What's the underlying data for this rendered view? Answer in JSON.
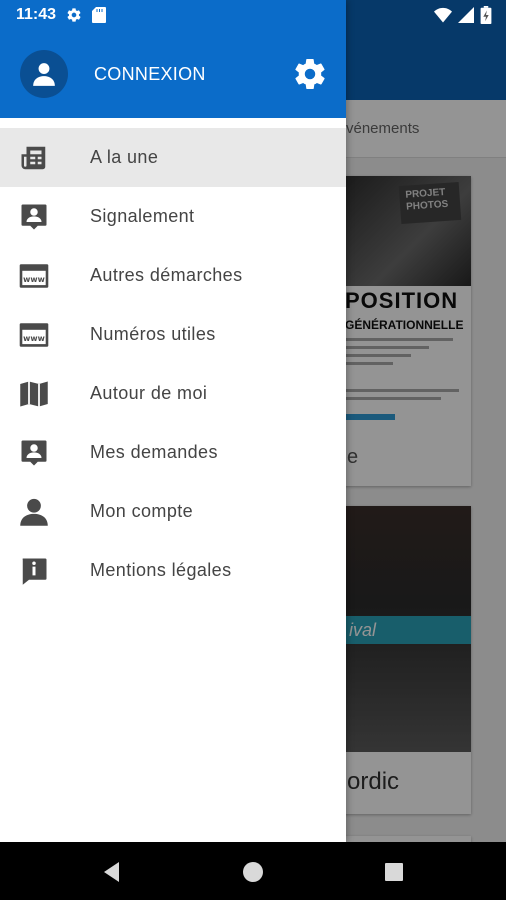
{
  "status_bar": {
    "time": "11:43",
    "icons": [
      "gear-icon",
      "sd-card-icon",
      "wifi-icon",
      "signal-icon",
      "battery-icon"
    ]
  },
  "drawer": {
    "header": {
      "login_label": "CONNEXION",
      "background_color": "#0b6cc9"
    },
    "menu": [
      {
        "label": "A la une",
        "icon": "newspaper-icon",
        "active": true
      },
      {
        "label": "Signalement",
        "icon": "report-icon",
        "active": false
      },
      {
        "label": "Autres démarches",
        "icon": "web-window-icon",
        "active": false
      },
      {
        "label": "Numéros utiles",
        "icon": "web-window-icon",
        "active": false
      },
      {
        "label": "Autour de moi",
        "icon": "map-icon",
        "active": false
      },
      {
        "label": "Mes demandes",
        "icon": "report-icon",
        "active": false
      },
      {
        "label": "Mon compte",
        "icon": "person-icon",
        "active": false
      },
      {
        "label": "Mentions légales",
        "icon": "info-icon",
        "active": false
      }
    ]
  },
  "background_app": {
    "tab_text": "vénements",
    "card1": {
      "poster_chip": "PROJET PHOTOS",
      "poster_title": "POSITION",
      "poster_subtitle": "GÉNÉRATIONNELLE",
      "suffix": "e"
    },
    "card2": {
      "banner_text": "ival",
      "suffix": "ordic"
    }
  },
  "colors": {
    "accent": "#0b6cc9",
    "active_item_bg": "#e8e8e8",
    "icon_color": "#4a4a4a"
  }
}
